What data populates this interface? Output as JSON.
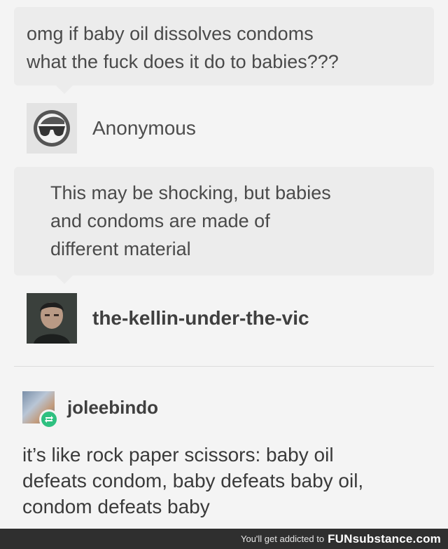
{
  "ask": {
    "lines": [
      "omg if baby oil dissolves condoms",
      "what the fuck does it do to babies???"
    ]
  },
  "users": {
    "asker": "Anonymous",
    "answerer": "the-kellin-under-the-vic",
    "reblogger": "joleebindo"
  },
  "answer": {
    "lines": [
      "This may be shocking, but babies",
      "and condoms are made of",
      "different material"
    ]
  },
  "reblog": {
    "lines": [
      "it’s like rock paper scissors: baby oil",
      "defeats condom, baby defeats baby oil,",
      "condom defeats baby"
    ]
  },
  "footer": {
    "tagline": "You'll get addicted to",
    "brand": "FUNsubstance.com"
  },
  "icons": {
    "anon_avatar": "anonymous-sunglasses-icon",
    "kellin_avatar": "user-photo",
    "jolee_avatar": "user-photo",
    "reblog_badge": "reblog-icon"
  },
  "colors": {
    "bubble": "#ececec",
    "reblog_green": "#2ec080",
    "footer_bg": "#2f2f2f"
  }
}
